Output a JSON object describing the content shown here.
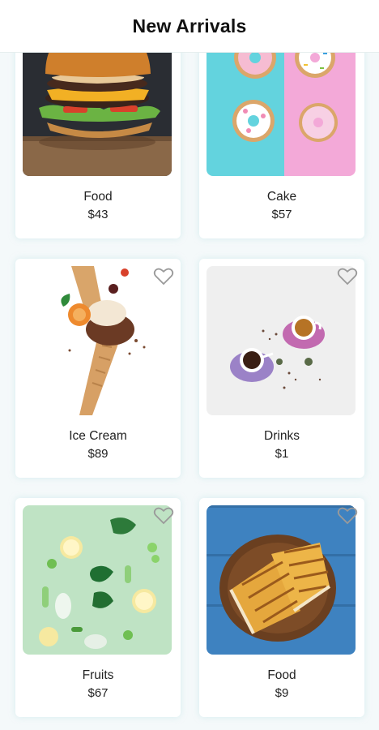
{
  "header": {
    "title": "New Arrivals"
  },
  "products": [
    {
      "name": "Food",
      "price": "$43",
      "image": "burger"
    },
    {
      "name": "Cake",
      "price": "$57",
      "image": "donuts"
    },
    {
      "name": "Ice Cream",
      "price": "$89",
      "image": "ice-cream-cone"
    },
    {
      "name": "Drinks",
      "price": "$1",
      "image": "tea-cups"
    },
    {
      "name": "Fruits",
      "price": "$67",
      "image": "sliced-vegetables"
    },
    {
      "name": "Food",
      "price": "$9",
      "image": "grilled-sandwich"
    }
  ],
  "favorite_icon": "heart-outline-icon",
  "colors": {
    "background": "#f4f9fa",
    "card": "#ffffff",
    "heart": "#9a9a9a"
  }
}
